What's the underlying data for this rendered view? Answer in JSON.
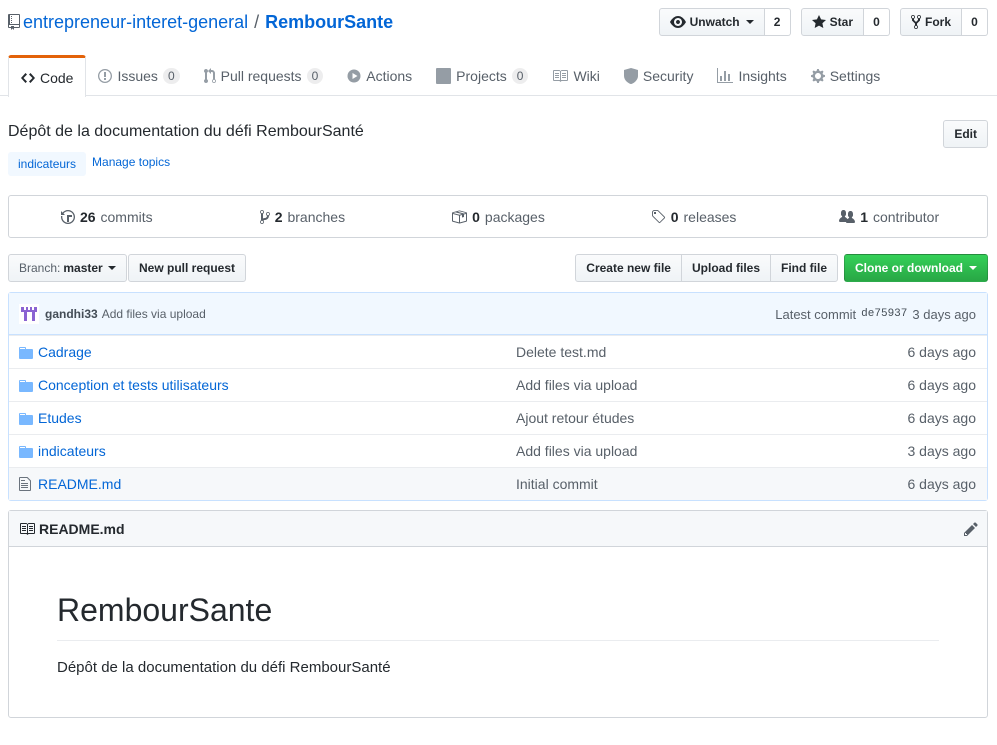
{
  "repo": {
    "owner": "entrepreneur-interet-general",
    "separator": "/",
    "name": "RembourSante"
  },
  "actions": {
    "watch": {
      "label": "Unwatch",
      "count": "2",
      "icon": "eye-icon"
    },
    "star": {
      "label": "Star",
      "count": "0",
      "icon": "star-icon"
    },
    "fork": {
      "label": "Fork",
      "count": "0",
      "icon": "fork-icon"
    }
  },
  "tabs": [
    {
      "label": "Code",
      "icon": "code-icon",
      "counter": null,
      "selected": true
    },
    {
      "label": "Issues",
      "icon": "issue-icon",
      "counter": "0"
    },
    {
      "label": "Pull requests",
      "icon": "pull-request-icon",
      "counter": "0"
    },
    {
      "label": "Actions",
      "icon": "play-icon",
      "counter": null
    },
    {
      "label": "Projects",
      "icon": "project-icon",
      "counter": "0"
    },
    {
      "label": "Wiki",
      "icon": "book-icon",
      "counter": null
    },
    {
      "label": "Security",
      "icon": "shield-icon",
      "counter": null
    },
    {
      "label": "Insights",
      "icon": "graph-icon",
      "counter": null
    },
    {
      "label": "Settings",
      "icon": "gear-icon",
      "counter": null
    }
  ],
  "description": "Dépôt de la documentation du défi RembourSanté",
  "edit_label": "Edit",
  "topics": {
    "tags": [
      "indicateurs"
    ],
    "manage_label": "Manage topics"
  },
  "summary": {
    "commits": {
      "count": "26",
      "label": "commits"
    },
    "branches": {
      "count": "2",
      "label": "branches"
    },
    "packages": {
      "count": "0",
      "label": "packages"
    },
    "releases": {
      "count": "0",
      "label": "releases"
    },
    "contributors": {
      "count": "1",
      "label": "contributor"
    }
  },
  "file_nav": {
    "branch_label": "Branch:",
    "branch_value": "master",
    "new_pr": "New pull request",
    "create_file": "Create new file",
    "upload_files": "Upload files",
    "find_file": "Find file",
    "clone": "Clone or download"
  },
  "commit": {
    "author": "gandhi33",
    "message": "Add files via upload",
    "latest_label": "Latest commit",
    "sha": "de75937",
    "age": "3 days ago"
  },
  "files": [
    {
      "name": "Cadrage",
      "type": "folder",
      "message": "Delete test.md",
      "age": "6 days ago"
    },
    {
      "name": "Conception et tests utilisateurs",
      "type": "folder",
      "message": "Add files via upload",
      "age": "6 days ago"
    },
    {
      "name": "Etudes",
      "type": "folder",
      "message": "Ajout retour études",
      "age": "6 days ago"
    },
    {
      "name": "indicateurs",
      "type": "folder",
      "message": "Add files via upload",
      "age": "3 days ago"
    },
    {
      "name": "README.md",
      "type": "file",
      "message": "Initial commit",
      "age": "6 days ago"
    }
  ],
  "readme": {
    "filename": "README.md",
    "title": "RembourSante",
    "body": "Dépôt de la documentation du défi RembourSanté"
  },
  "colors": {
    "accent": "#0366d6",
    "tab_active": "#e36209",
    "clone_green": "#28a745"
  }
}
